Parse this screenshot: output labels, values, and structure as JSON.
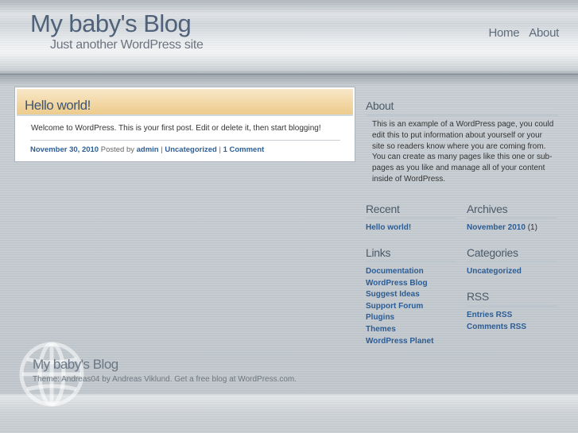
{
  "header": {
    "title": "My baby's Blog",
    "tagline": "Just another WordPress site",
    "nav": [
      "Home",
      "About"
    ]
  },
  "post": {
    "title": "Hello world!",
    "body": "Welcome to WordPress. This is your first post. Edit or delete it, then start blogging!",
    "date": "November 30, 2010",
    "posted_by": "Posted by",
    "author": "admin",
    "separator": "|",
    "category": "Uncategorized",
    "comments": "1 Comment"
  },
  "sidebar": {
    "about": {
      "title": "About",
      "text": "This is an example of a WordPress page, you could edit this to put information about yourself or your site so readers know where you are coming from. You can create as many pages like this one or sub-pages as you like and manage all of your content inside of WordPress."
    },
    "recent": {
      "title": "Recent",
      "items": [
        "Hello world!"
      ]
    },
    "archives": {
      "title": "Archives",
      "items": [
        {
          "label": "November 2010",
          "count": "(1)"
        }
      ]
    },
    "links": {
      "title": "Links",
      "items": [
        "Documentation",
        "WordPress Blog",
        "Suggest Ideas",
        "Support Forum",
        "Plugins",
        "Themes",
        "WordPress Planet"
      ]
    },
    "categories": {
      "title": "Categories",
      "items": [
        "Uncategorized"
      ]
    },
    "rss": {
      "title": "RSS",
      "items": [
        "Entries RSS",
        "Comments RSS"
      ]
    }
  },
  "footer": {
    "title": "My baby's Blog",
    "credit": "Theme: Andreas04 by Andreas Viklund. Get a free blog at WordPress.com."
  },
  "colors": {
    "link": "#2c5c94",
    "title": "#50617a",
    "post_title_bar": "#f3d8a6"
  },
  "icons": {
    "footer_logo": "wordpress-globe-icon"
  }
}
